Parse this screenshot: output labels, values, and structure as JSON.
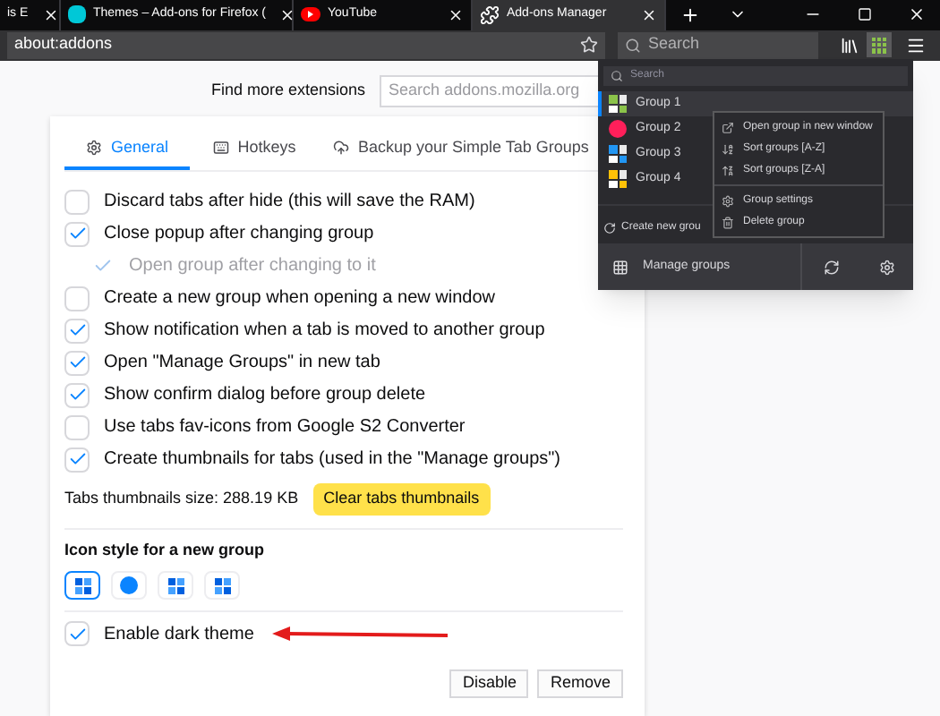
{
  "browser_tabs": [
    {
      "title": "is E",
      "selected": false
    },
    {
      "title": "Themes – Add-ons for Firefox (",
      "selected": false
    },
    {
      "title": "YouTube",
      "selected": false
    },
    {
      "title": "Add-ons Manager",
      "selected": true
    }
  ],
  "address": "about:addons",
  "search": {
    "placeholder": "Search"
  },
  "find_more": {
    "label": "Find more extensions",
    "placeholder": "Search addons.mozilla.org"
  },
  "settings_tabs": [
    {
      "label": "General",
      "selected": true
    },
    {
      "label": "Hotkeys",
      "selected": false
    },
    {
      "label": "Backup your Simple Tab Groups",
      "selected": false
    }
  ],
  "options": [
    {
      "label": "Discard tabs after hide (this will save the RAM)",
      "checked": false
    },
    {
      "label": "Close popup after changing group",
      "checked": true,
      "children": [
        {
          "label": "Open group after changing to it",
          "checked": true,
          "disabled": true
        }
      ]
    },
    {
      "label": "Create a new group when opening a new window",
      "checked": false
    },
    {
      "label": "Show notification when a tab is moved to another group",
      "checked": true
    },
    {
      "label": "Open \"Manage Groups\" in new tab",
      "checked": true
    },
    {
      "label": "Show confirm dialog before group delete",
      "checked": true
    },
    {
      "label": "Use tabs fav-icons from Google S2 Converter",
      "checked": false
    },
    {
      "label": "Create thumbnails for tabs (used in the \"Manage groups\")",
      "checked": true
    }
  ],
  "thumbnails": {
    "label": "Tabs thumbnails size: 288.19 KB",
    "button": "Clear tabs thumbnails"
  },
  "icon_style": {
    "heading": "Icon style for a new group",
    "options": [
      {
        "kind": "squares",
        "selected": true
      },
      {
        "kind": "circle",
        "selected": false
      },
      {
        "kind": "squares",
        "selected": false
      },
      {
        "kind": "squares",
        "selected": false
      }
    ]
  },
  "dark_theme": {
    "label": "Enable dark theme",
    "checked": true
  },
  "buttons": [
    "Disable",
    "Remove"
  ],
  "popup": {
    "search_placeholder": "Search",
    "groups": [
      {
        "name": "Group 1",
        "kind": "squares",
        "color": "#8bc34a",
        "selected": true
      },
      {
        "name": "Group 2",
        "kind": "circle",
        "color": "#ff1f5a",
        "selected": false
      },
      {
        "name": "Group 3",
        "kind": "squares",
        "color": "#2196f3",
        "selected": false
      },
      {
        "name": "Group 4",
        "kind": "squares",
        "color": "#ffc107",
        "selected": false
      }
    ],
    "create_label": "Create new grou",
    "manage_label": "Manage groups"
  },
  "context_menu": [
    [
      {
        "label": "Open group in new window"
      },
      {
        "label": "Sort groups [A-Z]"
      },
      {
        "label": "Sort groups [Z-A]"
      }
    ],
    [
      {
        "label": "Group settings"
      },
      {
        "label": "Delete group"
      }
    ]
  ]
}
